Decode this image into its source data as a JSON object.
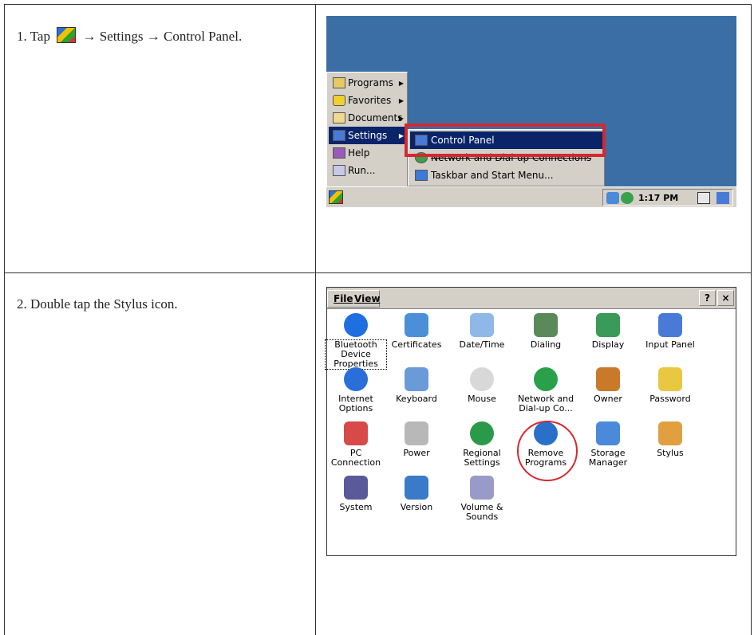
{
  "steps": [
    {
      "number": "1.",
      "text_prefix": "Tap",
      "text_suffix": "→ Settings → Control Panel."
    },
    {
      "number": "2.",
      "text": "Double tap the Stylus icon."
    }
  ],
  "start_menu": {
    "items": [
      {
        "label": "Programs",
        "icon": "programs-icon",
        "has_submenu": true
      },
      {
        "label": "Favorites",
        "icon": "favorites-icon",
        "has_submenu": true
      },
      {
        "label": "Documents",
        "icon": "documents-icon",
        "has_submenu": true
      },
      {
        "label": "Settings",
        "icon": "settings-icon",
        "has_submenu": true,
        "selected": true
      },
      {
        "label": "Help",
        "icon": "help-icon",
        "has_submenu": false
      },
      {
        "label": "Run...",
        "icon": "run-icon",
        "has_submenu": false
      }
    ],
    "submenu": [
      {
        "label": "Control Panel",
        "icon": "control-panel-icon",
        "selected": true
      },
      {
        "label": "Network and Dial-up Connections",
        "icon": "network-icon"
      },
      {
        "label": "Taskbar and Start Menu...",
        "icon": "taskbar-icon"
      }
    ],
    "clock": "1:17 PM"
  },
  "control_panel": {
    "menus": [
      "File",
      "View"
    ],
    "help_button": "?",
    "close_button": "×",
    "items": [
      {
        "label_lines": [
          "Bluetooth",
          "Device",
          "Properties"
        ],
        "icon": "bluetooth-icon",
        "color": "#1e6fe0"
      },
      {
        "label_lines": [
          "Certificates"
        ],
        "icon": "certificates-icon",
        "color": "#4a8fd8"
      },
      {
        "label_lines": [
          "Date/Time"
        ],
        "icon": "clock-icon",
        "color": "#8fb8e8"
      },
      {
        "label_lines": [
          "Dialing"
        ],
        "icon": "phone-icon",
        "color": "#5a8a5a"
      },
      {
        "label_lines": [
          "Display"
        ],
        "icon": "display-icon",
        "color": "#3a9a5a"
      },
      {
        "label_lines": [
          "Input Panel"
        ],
        "icon": "input-panel-icon",
        "color": "#4a7ad8"
      },
      {
        "label_lines": [
          "Internet",
          "Options"
        ],
        "icon": "internet-icon",
        "color": "#2a6ed8"
      },
      {
        "label_lines": [
          "Keyboard"
        ],
        "icon": "keyboard-icon",
        "color": "#6a9ad8"
      },
      {
        "label_lines": [
          "Mouse"
        ],
        "icon": "mouse-icon",
        "color": "#d8d8d8"
      },
      {
        "label_lines": [
          "Network and",
          "Dial-up Co..."
        ],
        "icon": "network-globe-icon",
        "color": "#2aa04a"
      },
      {
        "label_lines": [
          "Owner"
        ],
        "icon": "owner-icon",
        "color": "#c87a2a"
      },
      {
        "label_lines": [
          "Password"
        ],
        "icon": "password-key-icon",
        "color": "#e8c840"
      },
      {
        "label_lines": [
          "PC",
          "Connection"
        ],
        "icon": "pc-connection-icon",
        "color": "#d84a4a"
      },
      {
        "label_lines": [
          "Power"
        ],
        "icon": "power-plug-icon",
        "color": "#b8b8b8"
      },
      {
        "label_lines": [
          "Regional",
          "Settings"
        ],
        "icon": "regional-globe-icon",
        "color": "#2a9a4a"
      },
      {
        "label_lines": [
          "Remove",
          "Programs"
        ],
        "icon": "remove-programs-icon",
        "color": "#2a70c8"
      },
      {
        "label_lines": [
          "Storage",
          "Manager"
        ],
        "icon": "storage-icon",
        "color": "#4a8ad8"
      },
      {
        "label_lines": [
          "Stylus"
        ],
        "icon": "stylus-icon",
        "color": "#e0a040"
      },
      {
        "label_lines": [
          "System"
        ],
        "icon": "system-icon",
        "color": "#5a5a9a"
      },
      {
        "label_lines": [
          "Version"
        ],
        "icon": "version-icon",
        "color": "#3a7ac8"
      },
      {
        "label_lines": [
          "Volume &",
          "Sounds"
        ],
        "icon": "volume-icon",
        "color": "#9a9ac8"
      }
    ]
  },
  "colors": {
    "desktop": "#3a6ea5",
    "menu_bg": "#d4d0c8",
    "selection": "#0a246a",
    "annotation_red": "#d6282e"
  }
}
